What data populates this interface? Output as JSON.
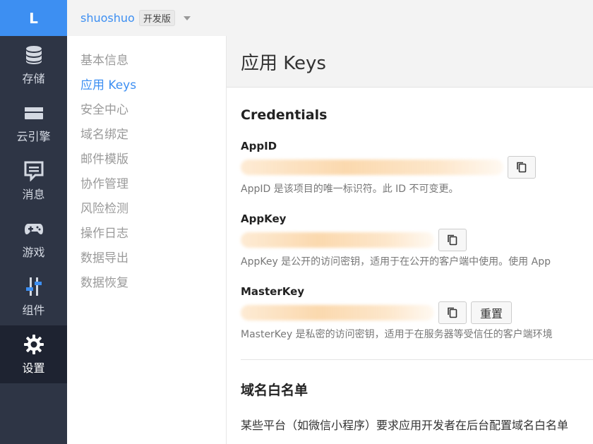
{
  "rail": {
    "logo": "L",
    "items": [
      {
        "label": "存储",
        "icon": "database-icon"
      },
      {
        "label": "云引擎",
        "icon": "server-icon"
      },
      {
        "label": "消息",
        "icon": "message-icon"
      },
      {
        "label": "游戏",
        "icon": "gamepad-icon"
      },
      {
        "label": "组件",
        "icon": "sliders-icon"
      },
      {
        "label": "设置",
        "icon": "gear-icon"
      }
    ]
  },
  "topbar": {
    "app_name": "shuoshuo",
    "env_badge": "开发版"
  },
  "subnav": {
    "items": [
      "基本信息",
      "应用 Keys",
      "安全中心",
      "域名绑定",
      "邮件模版",
      "协作管理",
      "风险检测",
      "操作日志",
      "数据导出",
      "数据恢复"
    ],
    "active": "应用 Keys"
  },
  "main": {
    "title": "应用 Keys",
    "credentials": {
      "title": "Credentials",
      "appid": {
        "label": "AppID",
        "help": "AppID 是该项目的唯一标识符。此 ID 不可变更。"
      },
      "appkey": {
        "label": "AppKey",
        "help": "AppKey 是公开的访问密钥，适用于在公开的客户端中使用。使用 App"
      },
      "masterkey": {
        "label": "MasterKey",
        "help": "MasterKey 是私密的访问密钥，适用于在服务器等受信任的客户端环境"
      },
      "reset_label": "重置"
    },
    "whitelist": {
      "title": "域名白名单",
      "text": "某些平台（如微信小程序）要求应用开发者在后台配置域名白名单"
    }
  },
  "colors": {
    "accent": "#3d8ff2",
    "rail_bg": "#2e3545",
    "rail_active_bg": "#1e2331"
  }
}
